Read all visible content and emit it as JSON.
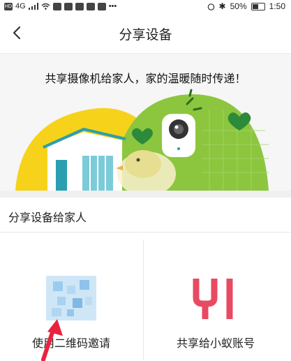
{
  "status_bar": {
    "network": "4G",
    "battery_percent": "50%",
    "time": "1:50"
  },
  "nav": {
    "title": "分享设备"
  },
  "banner": {
    "tagline": "共享摄像机给家人，家的温暖随时传递！"
  },
  "section": {
    "title": "分享设备给家人"
  },
  "options": [
    {
      "label": "使用二维码邀请",
      "icon": "qr-code-icon"
    },
    {
      "label": "共享给小蚁账号",
      "icon": "yi-logo-icon"
    }
  ],
  "colors": {
    "accent_red": "#e84a62",
    "banner_yellow": "#f7d21a",
    "banner_green": "#8cc63e",
    "house_teal": "#2a9fb0"
  }
}
